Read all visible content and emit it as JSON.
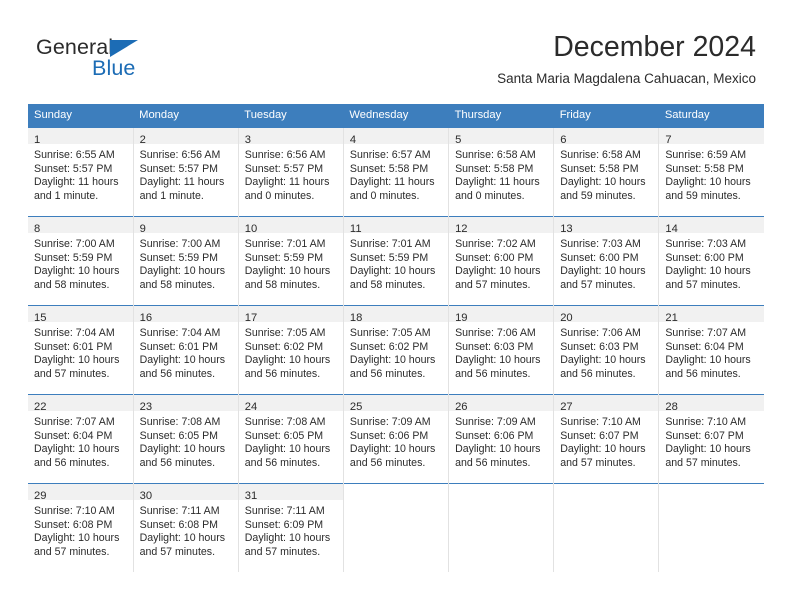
{
  "logo": {
    "word_one": "General",
    "word_two": "Blue",
    "flag_icon": "blue-triangle-flag-icon",
    "accent_color": "#1c6cb5"
  },
  "header": {
    "title": "December 2024",
    "subtitle": "Santa Maria Magdalena Cahuacan, Mexico"
  },
  "calendar": {
    "header_color": "#3d7ebd",
    "daynum_band_color": "#f1f1f1",
    "weekdays": [
      "Sunday",
      "Monday",
      "Tuesday",
      "Wednesday",
      "Thursday",
      "Friday",
      "Saturday"
    ],
    "weeks": [
      [
        {
          "day": "1",
          "sunrise": "Sunrise: 6:55 AM",
          "sunset": "Sunset: 5:57 PM",
          "daylight_line1": "Daylight: 11 hours",
          "daylight_line2": "and 1 minute."
        },
        {
          "day": "2",
          "sunrise": "Sunrise: 6:56 AM",
          "sunset": "Sunset: 5:57 PM",
          "daylight_line1": "Daylight: 11 hours",
          "daylight_line2": "and 1 minute."
        },
        {
          "day": "3",
          "sunrise": "Sunrise: 6:56 AM",
          "sunset": "Sunset: 5:57 PM",
          "daylight_line1": "Daylight: 11 hours",
          "daylight_line2": "and 0 minutes."
        },
        {
          "day": "4",
          "sunrise": "Sunrise: 6:57 AM",
          "sunset": "Sunset: 5:58 PM",
          "daylight_line1": "Daylight: 11 hours",
          "daylight_line2": "and 0 minutes."
        },
        {
          "day": "5",
          "sunrise": "Sunrise: 6:58 AM",
          "sunset": "Sunset: 5:58 PM",
          "daylight_line1": "Daylight: 11 hours",
          "daylight_line2": "and 0 minutes."
        },
        {
          "day": "6",
          "sunrise": "Sunrise: 6:58 AM",
          "sunset": "Sunset: 5:58 PM",
          "daylight_line1": "Daylight: 10 hours",
          "daylight_line2": "and 59 minutes."
        },
        {
          "day": "7",
          "sunrise": "Sunrise: 6:59 AM",
          "sunset": "Sunset: 5:58 PM",
          "daylight_line1": "Daylight: 10 hours",
          "daylight_line2": "and 59 minutes."
        }
      ],
      [
        {
          "day": "8",
          "sunrise": "Sunrise: 7:00 AM",
          "sunset": "Sunset: 5:59 PM",
          "daylight_line1": "Daylight: 10 hours",
          "daylight_line2": "and 58 minutes."
        },
        {
          "day": "9",
          "sunrise": "Sunrise: 7:00 AM",
          "sunset": "Sunset: 5:59 PM",
          "daylight_line1": "Daylight: 10 hours",
          "daylight_line2": "and 58 minutes."
        },
        {
          "day": "10",
          "sunrise": "Sunrise: 7:01 AM",
          "sunset": "Sunset: 5:59 PM",
          "daylight_line1": "Daylight: 10 hours",
          "daylight_line2": "and 58 minutes."
        },
        {
          "day": "11",
          "sunrise": "Sunrise: 7:01 AM",
          "sunset": "Sunset: 5:59 PM",
          "daylight_line1": "Daylight: 10 hours",
          "daylight_line2": "and 58 minutes."
        },
        {
          "day": "12",
          "sunrise": "Sunrise: 7:02 AM",
          "sunset": "Sunset: 6:00 PM",
          "daylight_line1": "Daylight: 10 hours",
          "daylight_line2": "and 57 minutes."
        },
        {
          "day": "13",
          "sunrise": "Sunrise: 7:03 AM",
          "sunset": "Sunset: 6:00 PM",
          "daylight_line1": "Daylight: 10 hours",
          "daylight_line2": "and 57 minutes."
        },
        {
          "day": "14",
          "sunrise": "Sunrise: 7:03 AM",
          "sunset": "Sunset: 6:00 PM",
          "daylight_line1": "Daylight: 10 hours",
          "daylight_line2": "and 57 minutes."
        }
      ],
      [
        {
          "day": "15",
          "sunrise": "Sunrise: 7:04 AM",
          "sunset": "Sunset: 6:01 PM",
          "daylight_line1": "Daylight: 10 hours",
          "daylight_line2": "and 57 minutes."
        },
        {
          "day": "16",
          "sunrise": "Sunrise: 7:04 AM",
          "sunset": "Sunset: 6:01 PM",
          "daylight_line1": "Daylight: 10 hours",
          "daylight_line2": "and 56 minutes."
        },
        {
          "day": "17",
          "sunrise": "Sunrise: 7:05 AM",
          "sunset": "Sunset: 6:02 PM",
          "daylight_line1": "Daylight: 10 hours",
          "daylight_line2": "and 56 minutes."
        },
        {
          "day": "18",
          "sunrise": "Sunrise: 7:05 AM",
          "sunset": "Sunset: 6:02 PM",
          "daylight_line1": "Daylight: 10 hours",
          "daylight_line2": "and 56 minutes."
        },
        {
          "day": "19",
          "sunrise": "Sunrise: 7:06 AM",
          "sunset": "Sunset: 6:03 PM",
          "daylight_line1": "Daylight: 10 hours",
          "daylight_line2": "and 56 minutes."
        },
        {
          "day": "20",
          "sunrise": "Sunrise: 7:06 AM",
          "sunset": "Sunset: 6:03 PM",
          "daylight_line1": "Daylight: 10 hours",
          "daylight_line2": "and 56 minutes."
        },
        {
          "day": "21",
          "sunrise": "Sunrise: 7:07 AM",
          "sunset": "Sunset: 6:04 PM",
          "daylight_line1": "Daylight: 10 hours",
          "daylight_line2": "and 56 minutes."
        }
      ],
      [
        {
          "day": "22",
          "sunrise": "Sunrise: 7:07 AM",
          "sunset": "Sunset: 6:04 PM",
          "daylight_line1": "Daylight: 10 hours",
          "daylight_line2": "and 56 minutes."
        },
        {
          "day": "23",
          "sunrise": "Sunrise: 7:08 AM",
          "sunset": "Sunset: 6:05 PM",
          "daylight_line1": "Daylight: 10 hours",
          "daylight_line2": "and 56 minutes."
        },
        {
          "day": "24",
          "sunrise": "Sunrise: 7:08 AM",
          "sunset": "Sunset: 6:05 PM",
          "daylight_line1": "Daylight: 10 hours",
          "daylight_line2": "and 56 minutes."
        },
        {
          "day": "25",
          "sunrise": "Sunrise: 7:09 AM",
          "sunset": "Sunset: 6:06 PM",
          "daylight_line1": "Daylight: 10 hours",
          "daylight_line2": "and 56 minutes."
        },
        {
          "day": "26",
          "sunrise": "Sunrise: 7:09 AM",
          "sunset": "Sunset: 6:06 PM",
          "daylight_line1": "Daylight: 10 hours",
          "daylight_line2": "and 56 minutes."
        },
        {
          "day": "27",
          "sunrise": "Sunrise: 7:10 AM",
          "sunset": "Sunset: 6:07 PM",
          "daylight_line1": "Daylight: 10 hours",
          "daylight_line2": "and 57 minutes."
        },
        {
          "day": "28",
          "sunrise": "Sunrise: 7:10 AM",
          "sunset": "Sunset: 6:07 PM",
          "daylight_line1": "Daylight: 10 hours",
          "daylight_line2": "and 57 minutes."
        }
      ],
      [
        {
          "day": "29",
          "sunrise": "Sunrise: 7:10 AM",
          "sunset": "Sunset: 6:08 PM",
          "daylight_line1": "Daylight: 10 hours",
          "daylight_line2": "and 57 minutes."
        },
        {
          "day": "30",
          "sunrise": "Sunrise: 7:11 AM",
          "sunset": "Sunset: 6:08 PM",
          "daylight_line1": "Daylight: 10 hours",
          "daylight_line2": "and 57 minutes."
        },
        {
          "day": "31",
          "sunrise": "Sunrise: 7:11 AM",
          "sunset": "Sunset: 6:09 PM",
          "daylight_line1": "Daylight: 10 hours",
          "daylight_line2": "and 57 minutes."
        },
        {
          "day": "",
          "sunrise": "",
          "sunset": "",
          "daylight_line1": "",
          "daylight_line2": ""
        },
        {
          "day": "",
          "sunrise": "",
          "sunset": "",
          "daylight_line1": "",
          "daylight_line2": ""
        },
        {
          "day": "",
          "sunrise": "",
          "sunset": "",
          "daylight_line1": "",
          "daylight_line2": ""
        },
        {
          "day": "",
          "sunrise": "",
          "sunset": "",
          "daylight_line1": "",
          "daylight_line2": ""
        }
      ]
    ]
  }
}
